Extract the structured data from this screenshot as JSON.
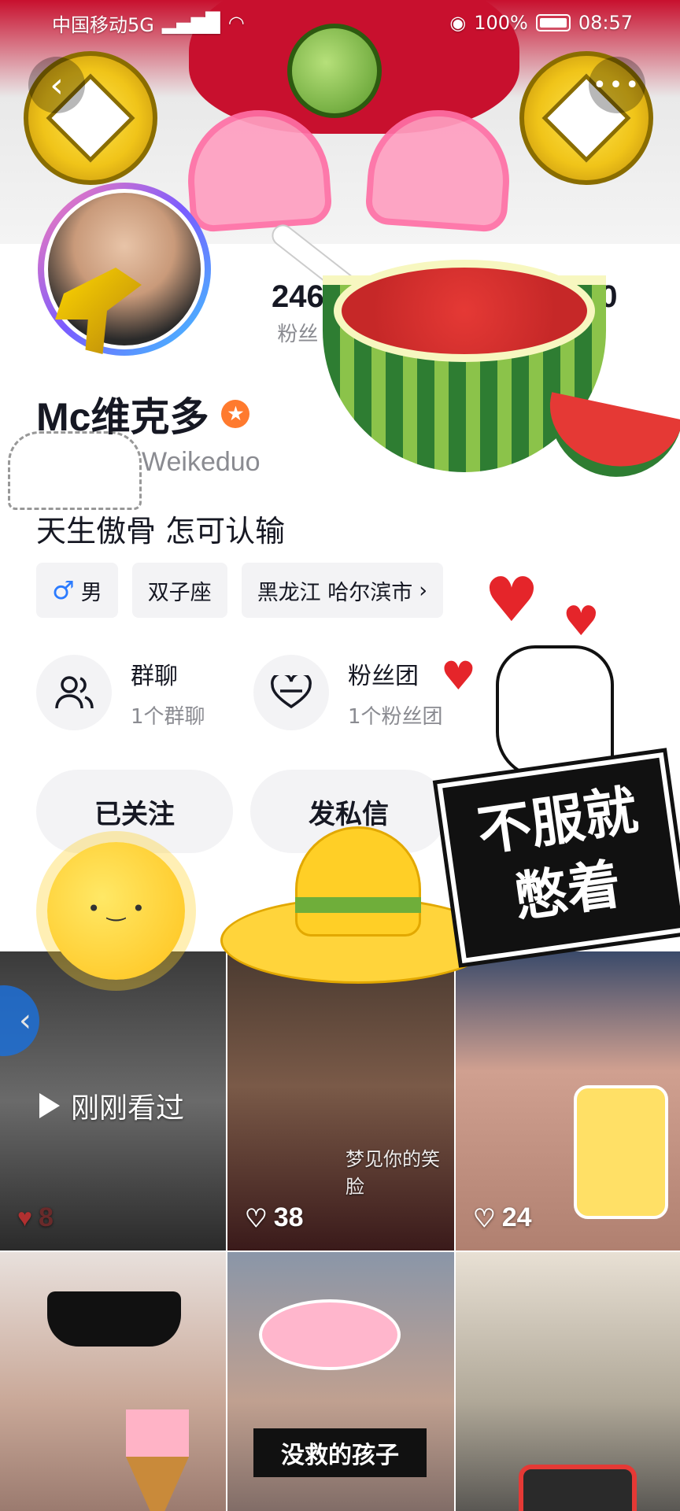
{
  "status_bar": {
    "carrier": "中国移动5G",
    "battery": "100%",
    "time": "08:57"
  },
  "profile": {
    "name": "Mc维克多",
    "handle": "Weikeduo",
    "bio": "天生傲骨 怎可认输",
    "stats": [
      {
        "value": "246",
        "label": "粉丝"
      },
      {
        "value": "10",
        "label": ""
      }
    ],
    "tags": {
      "gender": "男",
      "zodiac": "双子座",
      "location": "黑龙江 哈尔滨市"
    }
  },
  "features": {
    "group_chat": {
      "title": "群聊",
      "subtitle": "1个群聊"
    },
    "fan_club": {
      "title": "粉丝团",
      "subtitle": "1个粉丝团"
    }
  },
  "actions": {
    "followed": "已关注",
    "message": "发私信"
  },
  "stickers": {
    "slogan": "不服就憋着",
    "caption_pool": "没救的孩子"
  },
  "videos": [
    {
      "likes": "8",
      "overlay": "刚刚看过"
    },
    {
      "likes": "38",
      "caption": "梦见你的笑脸"
    },
    {
      "likes": "24"
    },
    {},
    {},
    {}
  ],
  "colors": {
    "accent_orange": "#ff7a2e",
    "male_blue": "#2b7bff",
    "heart_red": "#e5252a"
  }
}
